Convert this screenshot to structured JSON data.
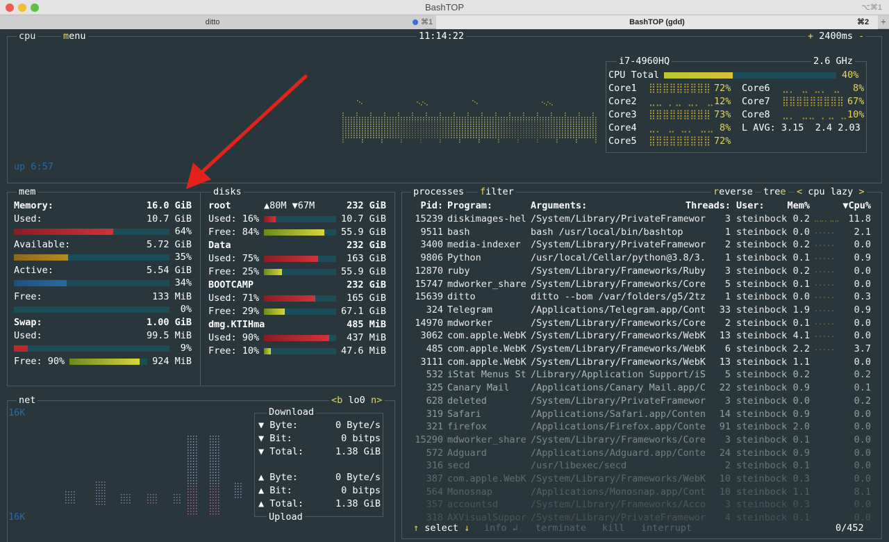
{
  "window": {
    "title": "BashTOP",
    "shortcut": "⌥⌘1"
  },
  "tabs": [
    {
      "label": "ditto",
      "shortcut": "⌘1"
    },
    {
      "label": "BashTOP (gdd)",
      "shortcut": "⌘2"
    }
  ],
  "cpu": {
    "box_label": "cpu",
    "menu_label": "menu",
    "clock": "11:14:22",
    "rate_plus": "+",
    "rate": "2400ms",
    "rate_minus": "-",
    "model": "i7-4960HQ",
    "freq": "2.6 GHz",
    "uptime": "up 6:57",
    "total": {
      "label": "CPU Total",
      "pct": "40%",
      "fill": 0.4
    },
    "cores": [
      {
        "name": "Core1",
        "pct": "72%"
      },
      {
        "name": "Core2",
        "pct": "12%"
      },
      {
        "name": "Core3",
        "pct": "73%"
      },
      {
        "name": "Core4",
        "pct": "8%"
      },
      {
        "name": "Core5",
        "pct": "72%"
      },
      {
        "name": "Core6",
        "pct": "8%"
      },
      {
        "name": "Core7",
        "pct": "67%"
      },
      {
        "name": "Core8",
        "pct": "10%"
      }
    ],
    "lavg_label": "L AVG:",
    "lavg": "3.15  2.4 2.03"
  },
  "mem": {
    "box_label": "mem",
    "memory_label": "Memory:",
    "memory_total": "16.0 GiB",
    "used_label": "Used:",
    "used": "10.7 GiB",
    "used_pct": "64%",
    "used_fill": 0.64,
    "avail_label": "Available:",
    "avail": "5.72 GiB",
    "avail_pct": "35%",
    "avail_fill": 0.35,
    "active_label": "Active:",
    "active": "5.54 GiB",
    "active_pct": "34%",
    "active_fill": 0.34,
    "free_label": "Free:",
    "free": "133 MiB",
    "free_pct": "0%",
    "free_fill": 0.0,
    "swap_label": "Swap:",
    "swap_total": "1.00 GiB",
    "swap_used_label": "Used:",
    "swap_used": "99.5 MiB",
    "swap_used_pct": "9%",
    "swap_used_fill": 0.09,
    "swap_free_label": "Free: 90%",
    "swap_free": "924 MiB",
    "swap_free_fill": 0.9
  },
  "disks": {
    "box_label": "disks",
    "root_label": "root",
    "io": "▲80M ▼67M",
    "root_total": "232 GiB",
    "items": [
      {
        "used_label": "Used: 16%",
        "used": "10.7 GiB",
        "used_fill": 0.16,
        "free_label": "Free: 84%",
        "free": "55.9 GiB",
        "free_fill": 0.84
      },
      {
        "name": "Data",
        "total": "232 GiB",
        "used_label": "Used: 75%",
        "used": "163 GiB",
        "used_fill": 0.75,
        "free_label": "Free: 25%",
        "free": "55.9 GiB",
        "free_fill": 0.25
      },
      {
        "name": "BOOTCAMP",
        "total": "232 GiB",
        "used_label": "Used: 71%",
        "used": "165 GiB",
        "used_fill": 0.71,
        "free_label": "Free: 29%",
        "free": "67.1 GiB",
        "free_fill": 0.29
      },
      {
        "name": "dmg.KTIHma",
        "total": "485 MiB",
        "used_label": "Used: 90%",
        "used": "437 MiB",
        "used_fill": 0.9,
        "free_label": "Free: 10%",
        "free": "47.6 MiB",
        "free_fill": 0.1
      }
    ]
  },
  "net": {
    "box_label": "net",
    "iface_prev": "<b",
    "iface": "lo0",
    "iface_next": "n>",
    "scale_top": "16K",
    "scale_bottom": "16K",
    "download_label": "Download",
    "upload_label": "Upload",
    "down": [
      {
        "k": "▼ Byte:",
        "v": "0 Byte/s"
      },
      {
        "k": "▼ Bit:",
        "v": "0 bitps"
      },
      {
        "k": "▼ Total:",
        "v": "1.38 GiB"
      }
    ],
    "up": [
      {
        "k": "▲ Byte:",
        "v": "0 Byte/s"
      },
      {
        "k": "▲ Bit:",
        "v": "0 bitps"
      },
      {
        "k": "▲ Total:",
        "v": "1.38 GiB"
      }
    ]
  },
  "proc": {
    "box_label": "processes",
    "filter_label": "filter",
    "reverse_label": "reverse",
    "tree_label": "tree",
    "sort_prev": "<",
    "sort": "cpu lazy",
    "sort_next": ">",
    "headers": {
      "pid": "Pid:",
      "program": "Program:",
      "args": "Arguments:",
      "threads": "Threads:",
      "user": "User:",
      "mem": "Mem%",
      "cpu": "▼Cpu%"
    },
    "rows": [
      {
        "pid": "15239",
        "prog": "diskimages-hel",
        "args": "/System/Library/PrivateFramewor",
        "th": "3",
        "user": "steinbock",
        "mem": "0.2",
        "cpu": "11.8"
      },
      {
        "pid": "9511",
        "prog": "bash",
        "args": "bash /usr/local/bin/bashtop",
        "th": "1",
        "user": "steinbock",
        "mem": "0.0",
        "cpu": "2.1"
      },
      {
        "pid": "3400",
        "prog": "media-indexer",
        "args": "/System/Library/PrivateFramewor",
        "th": "2",
        "user": "steinbock",
        "mem": "0.2",
        "cpu": "0.0"
      },
      {
        "pid": "9806",
        "prog": "Python",
        "args": "/usr/local/Cellar/python@3.8/3.",
        "th": "1",
        "user": "steinbock",
        "mem": "0.1",
        "cpu": "0.9"
      },
      {
        "pid": "12870",
        "prog": "ruby",
        "args": "/System/Library/Frameworks/Ruby",
        "th": "3",
        "user": "steinbock",
        "mem": "0.2",
        "cpu": "0.0"
      },
      {
        "pid": "15747",
        "prog": "mdworker_share",
        "args": "/System/Library/Frameworks/Core",
        "th": "5",
        "user": "steinbock",
        "mem": "0.1",
        "cpu": "0.0"
      },
      {
        "pid": "15639",
        "prog": "ditto",
        "args": "ditto --bom /var/folders/g5/2tz",
        "th": "1",
        "user": "steinbock",
        "mem": "0.0",
        "cpu": "0.3"
      },
      {
        "pid": "324",
        "prog": "Telegram",
        "args": "/Applications/Telegram.app/Cont",
        "th": "33",
        "user": "steinbock",
        "mem": "1.9",
        "cpu": "0.9"
      },
      {
        "pid": "14970",
        "prog": "mdworker",
        "args": "/System/Library/Frameworks/Core",
        "th": "2",
        "user": "steinbock",
        "mem": "0.1",
        "cpu": "0.0"
      },
      {
        "pid": "3062",
        "prog": "com.apple.WebK",
        "args": "/System/Library/Frameworks/WebK",
        "th": "13",
        "user": "steinbock",
        "mem": "4.1",
        "cpu": "0.0"
      },
      {
        "pid": "485",
        "prog": "com.apple.WebK",
        "args": "/System/Library/Frameworks/WebK",
        "th": "6",
        "user": "steinbock",
        "mem": "2.2",
        "cpu": "3.7"
      },
      {
        "pid": "3111",
        "prog": "com.apple.WebK",
        "args": "/System/Library/Frameworks/WebK",
        "th": "13",
        "user": "steinbock",
        "mem": "1.1",
        "cpu": "0.0"
      },
      {
        "pid": "532",
        "prog": "iStat Menus St",
        "args": "/Library/Application Support/iS",
        "th": "5",
        "user": "steinbock",
        "mem": "0.2",
        "cpu": "0.2"
      },
      {
        "pid": "325",
        "prog": "Canary Mail",
        "args": "/Applications/Canary Mail.app/C",
        "th": "22",
        "user": "steinbock",
        "mem": "0.9",
        "cpu": "0.1"
      },
      {
        "pid": "628",
        "prog": "deleted",
        "args": "/System/Library/PrivateFramewor",
        "th": "3",
        "user": "steinbock",
        "mem": "0.0",
        "cpu": "0.2"
      },
      {
        "pid": "319",
        "prog": "Safari",
        "args": "/Applications/Safari.app/Conten",
        "th": "14",
        "user": "steinbock",
        "mem": "0.9",
        "cpu": "0.0"
      },
      {
        "pid": "321",
        "prog": "firefox",
        "args": "/Applications/Firefox.app/Conte",
        "th": "91",
        "user": "steinbock",
        "mem": "2.0",
        "cpu": "0.0"
      },
      {
        "pid": "15290",
        "prog": "mdworker_share",
        "args": "/System/Library/Frameworks/Core",
        "th": "3",
        "user": "steinbock",
        "mem": "0.1",
        "cpu": "0.0"
      },
      {
        "pid": "572",
        "prog": "Adguard",
        "args": "/Applications/Adguard.app/Conte",
        "th": "24",
        "user": "steinbock",
        "mem": "0.9",
        "cpu": "0.0"
      },
      {
        "pid": "316",
        "prog": "secd",
        "args": "/usr/libexec/secd",
        "th": "2",
        "user": "steinbock",
        "mem": "0.1",
        "cpu": "0.0"
      },
      {
        "pid": "387",
        "prog": "com.apple.WebK",
        "args": "/System/Library/Frameworks/WebK",
        "th": "10",
        "user": "steinbock",
        "mem": "0.3",
        "cpu": "0.0"
      },
      {
        "pid": "564",
        "prog": "Monosnap",
        "args": "/Applications/Monosnap.app/Cont",
        "th": "10",
        "user": "steinbock",
        "mem": "1.1",
        "cpu": "8.1"
      },
      {
        "pid": "357",
        "prog": "accountsd",
        "args": "/System/Library/Frameworks/Acco",
        "th": "3",
        "user": "steinbock",
        "mem": "0.3",
        "cpu": "0.0"
      },
      {
        "pid": "318",
        "prog": "AXVisualSuppor",
        "args": "/System/Library/PrivateFramewor",
        "th": "4",
        "user": "steinbock",
        "mem": "0.1",
        "cpu": "0.0"
      }
    ],
    "footer": {
      "up": "↑",
      "select": "select",
      "down": "↓",
      "info": "info ↲",
      "terminate": "terminate",
      "kill": "kill",
      "interrupt": "interrupt",
      "count": "0/452"
    }
  },
  "colors": {
    "bg": "#29373c",
    "border": "#4a5e63",
    "accent": "#e7d55b",
    "red": "#c0282c",
    "yellow_green": "#b5c93a",
    "blue": "#2a6aa0"
  }
}
